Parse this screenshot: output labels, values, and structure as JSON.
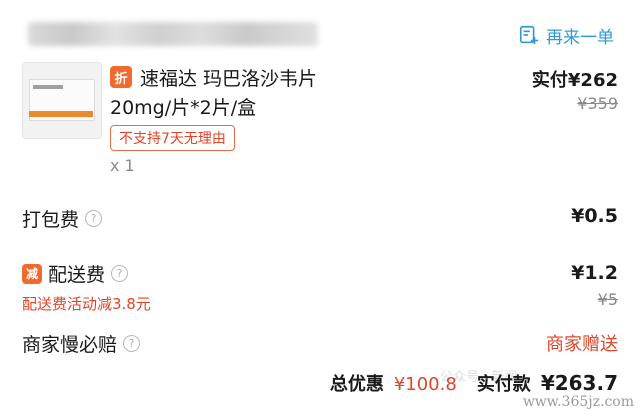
{
  "header": {
    "reorder_label": "再来一单",
    "reorder_color": "#2f9bd6"
  },
  "product": {
    "badge": "折",
    "name": "速福达 玛巴洛沙韦片",
    "spec": "20mg/片*2片/盒",
    "return_tag": "不支持7天无理由",
    "quantity": "x 1",
    "paid_label": "实付¥262",
    "original_price": "¥359"
  },
  "fees": {
    "packing_label": "打包费",
    "packing_amount": "¥0.5",
    "delivery_badge": "减",
    "delivery_label": "配送费",
    "delivery_amount": "¥1.2",
    "delivery_original": "¥5",
    "delivery_promo": "配送费活动减3.8元",
    "compensation_label": "商家慢必赔",
    "compensation_value": "商家赠送"
  },
  "summary": {
    "discount_label": "总优惠",
    "discount_value": "¥100.8",
    "total_label": "实付款",
    "total_value": "¥263.7"
  },
  "watermark": "公众号 · 新闻",
  "site": "www.365jz.com",
  "colors": {
    "accent_red": "#e0462a",
    "badge_orange": "#f06a2e",
    "muted": "#8a8a8a"
  }
}
